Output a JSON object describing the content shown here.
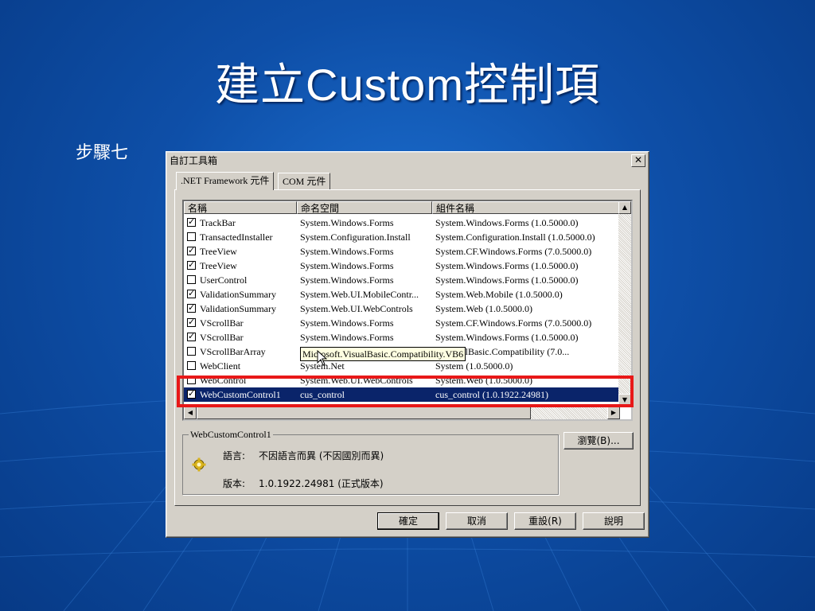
{
  "slide": {
    "title": "建立Custom控制項",
    "step_label": "步驟七"
  },
  "dialog": {
    "title": "自訂工具箱",
    "close_glyph": "✕",
    "tabs": [
      ".NET Framework 元件",
      "COM 元件"
    ],
    "columns": [
      "名稱",
      "命名空間",
      "組件名稱"
    ],
    "rows": [
      {
        "checked": true,
        "name": "TrackBar",
        "namespace": "System.Windows.Forms",
        "assembly": "System.Windows.Forms (1.0.5000.0)"
      },
      {
        "checked": false,
        "name": "TransactedInstaller",
        "namespace": "System.Configuration.Install",
        "assembly": "System.Configuration.Install (1.0.5000.0)"
      },
      {
        "checked": true,
        "name": "TreeView",
        "namespace": "System.Windows.Forms",
        "assembly": "System.CF.Windows.Forms (7.0.5000.0)"
      },
      {
        "checked": true,
        "name": "TreeView",
        "namespace": "System.Windows.Forms",
        "assembly": "System.Windows.Forms (1.0.5000.0)"
      },
      {
        "checked": false,
        "name": "UserControl",
        "namespace": "System.Windows.Forms",
        "assembly": "System.Windows.Forms (1.0.5000.0)"
      },
      {
        "checked": true,
        "name": "ValidationSummary",
        "namespace": "System.Web.UI.MobileContr...",
        "assembly": "System.Web.Mobile (1.0.5000.0)"
      },
      {
        "checked": true,
        "name": "ValidationSummary",
        "namespace": "System.Web.UI.WebControls",
        "assembly": "System.Web (1.0.5000.0)"
      },
      {
        "checked": true,
        "name": "VScrollBar",
        "namespace": "System.Windows.Forms",
        "assembly": "System.CF.Windows.Forms (7.0.5000.0)"
      },
      {
        "checked": true,
        "name": "VScrollBar",
        "namespace": "System.Windows.Forms",
        "assembly": "System.Windows.Forms (1.0.5000.0)"
      },
      {
        "checked": false,
        "name": "VScrollBarArray",
        "namespace": "",
        "assembly": "ft.VisualBasic.Compatibility (7.0..."
      },
      {
        "checked": false,
        "name": "WebClient",
        "namespace": "System.Net",
        "assembly": "System (1.0.5000.0)"
      },
      {
        "checked": false,
        "name": "WebControl",
        "namespace": "System.Web.UI.WebControls",
        "assembly": "System.Web (1.0.5000.0)"
      },
      {
        "checked": true,
        "name": "WebCustomControl1",
        "namespace": "cus_control",
        "assembly": "cus_control (1.0.1922.24981)",
        "selected": true
      }
    ],
    "tooltip": "Microsoft.VisualBasic.Compatibility.VB6",
    "details": {
      "group_title": "WebCustomControl1",
      "language_label": "語言:",
      "language_value": "不因語言而異 (不因國別而異)",
      "version_label": "版本:",
      "version_value": "1.0.1922.24981 (正式版本)"
    },
    "browse_button": "瀏覽(B)...",
    "buttons": {
      "ok": "確定",
      "cancel": "取消",
      "reset": "重設(R)",
      "help": "說明"
    }
  }
}
